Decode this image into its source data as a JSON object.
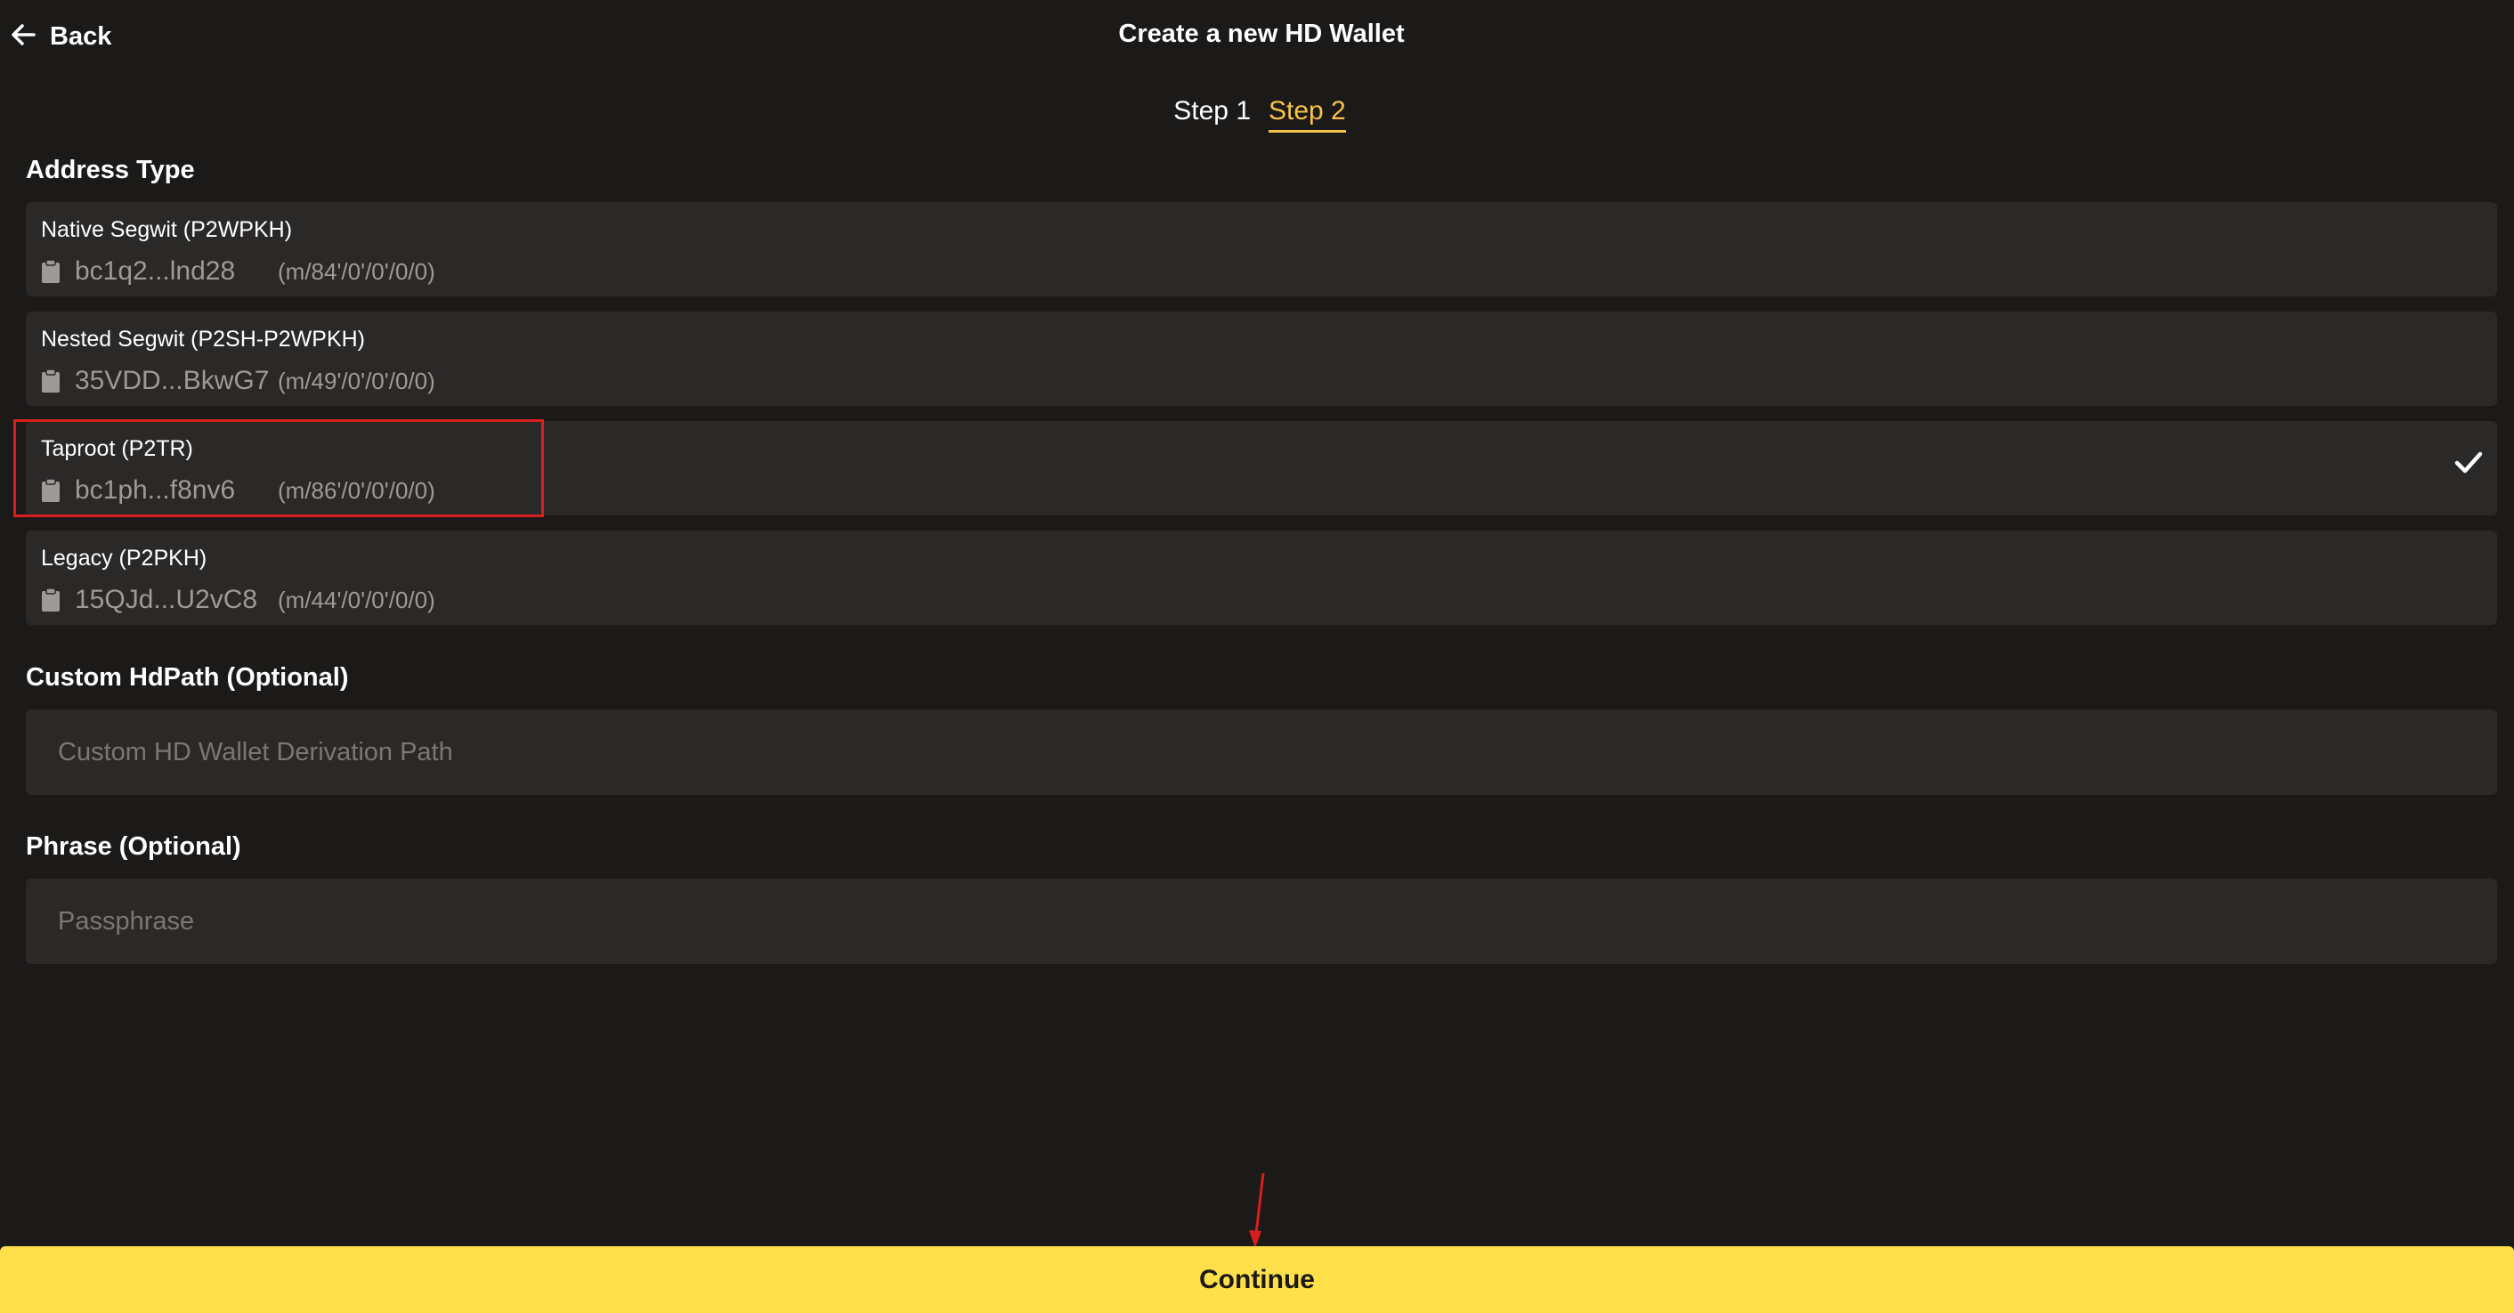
{
  "header": {
    "back_label": "Back",
    "title": "Create a new HD Wallet"
  },
  "steps": [
    {
      "label": "Step 1",
      "active": false
    },
    {
      "label": "Step 2",
      "active": true
    }
  ],
  "address_type": {
    "label": "Address Type",
    "options": [
      {
        "name": "Native Segwit (P2WPKH)",
        "address": "bc1q2...lnd28",
        "path": "(m/84'/0'/0'/0/0)",
        "selected": false
      },
      {
        "name": "Nested Segwit (P2SH-P2WPKH)",
        "address": "35VDD...BkwG7",
        "path": "(m/49'/0'/0'/0/0)",
        "selected": false
      },
      {
        "name": "Taproot (P2TR)",
        "address": "bc1ph...f8nv6",
        "path": "(m/86'/0'/0'/0/0)",
        "selected": true
      },
      {
        "name": "Legacy (P2PKH)",
        "address": "15QJd...U2vC8",
        "path": "(m/44'/0'/0'/0/0)",
        "selected": false
      }
    ]
  },
  "custom_hdpath": {
    "label": "Custom HdPath (Optional)",
    "placeholder": "Custom HD Wallet Derivation Path",
    "value": ""
  },
  "phrase": {
    "label": "Phrase (Optional)",
    "placeholder": "Passphrase",
    "value": ""
  },
  "continue_label": "Continue",
  "colors": {
    "background": "#1b1a19",
    "card": "#2b2928",
    "accent": "#f7c24a",
    "button": "#ffdf4a",
    "annotation": "#d81e1e"
  },
  "icons": {
    "back": "arrow-left-icon",
    "address_copy": "clipboard-icon",
    "selected": "checkmark-icon"
  }
}
